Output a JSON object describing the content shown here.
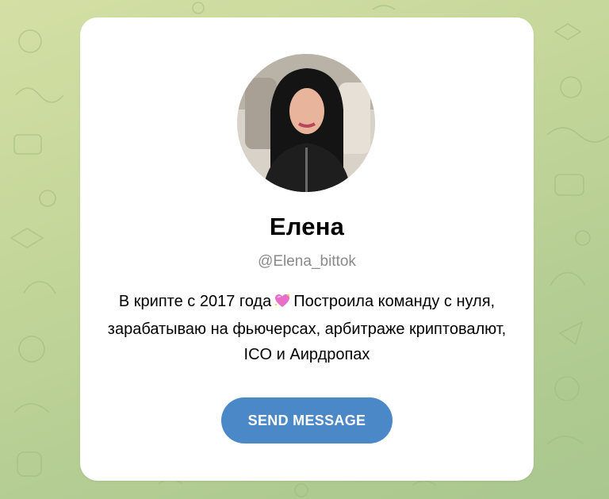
{
  "profile": {
    "name": "Елена",
    "username": "@Elena_bittok",
    "bio_part1": "В крипте с 2017 года",
    "bio_emoji": "sparkling-heart-icon",
    "bio_part2": "Построила команду с нуля, зарабатываю на фьючерсах, арбитраже криптовалют, ICO и Аирдропах"
  },
  "actions": {
    "send_message_label": "SEND MESSAGE"
  },
  "colors": {
    "background_light": "#d4dfa4",
    "background_dark": "#a9c78f",
    "card": "#ffffff",
    "button": "#4a88c7",
    "username_text": "#8a8a8a"
  }
}
